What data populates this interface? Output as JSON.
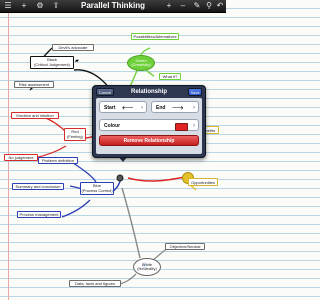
{
  "toolbar": {
    "title": "Parallel Thinking",
    "icons": [
      "menu-icon",
      "add-icon",
      "gear-icon",
      "share-icon",
      "add-node-icon",
      "minus-icon",
      "edit-icon",
      "link-icon",
      "undo-icon"
    ],
    "glyphs": {
      "menu": "☰",
      "add": "+",
      "gear": "⚙",
      "share": "⇪",
      "add_node": "+",
      "minus": "–",
      "edit": "✎",
      "link": "⚲",
      "undo": "↶"
    }
  },
  "nodes": {
    "devils_advocate": "Devil's advocate",
    "black": "Black",
    "black_sub": "(Critical Judgement)",
    "risk_assessment": "Risk assessment",
    "emotion_intuition": "Emotion and intuition",
    "red": "Red",
    "red_sub": "(Feeling)",
    "no_judgement": "No judgement",
    "problem_definition": "Problem definition",
    "summary_conclusion": "Summary and conclusion",
    "process_management": "Process management",
    "blue": "Blue",
    "blue_sub": "(Process Control)",
    "possibilities": "Possibilities/Alternatives",
    "green": "Green",
    "green_sub": "(Creativity)",
    "what_if": "What if?",
    "benefits": "Benefits",
    "opportunities": "Opportunities",
    "objective_neutral": "Objective/Neutral",
    "white": "White",
    "white_sub": "(Neutrality)",
    "data_facts": "Data, facts and figures"
  },
  "popover": {
    "cancel_label": "Cancel",
    "title": "Relationship",
    "save_label": "Save",
    "start_label": "Start",
    "start_arrow": "⟵",
    "end_label": "End",
    "end_arrow": "⟶",
    "chevron": "›",
    "colour_label": "Colour",
    "colour_value": "#e02424",
    "remove_label": "Remove Relationship"
  },
  "colors": {
    "black_hat": "#111111",
    "red_hat": "#d62a2a",
    "blue_hat": "#2c3fb6",
    "green_hat": "#6fd13a",
    "yellow_hat": "#e3c12a",
    "white_hat": "#ffffff",
    "relationship": "#e02424"
  }
}
